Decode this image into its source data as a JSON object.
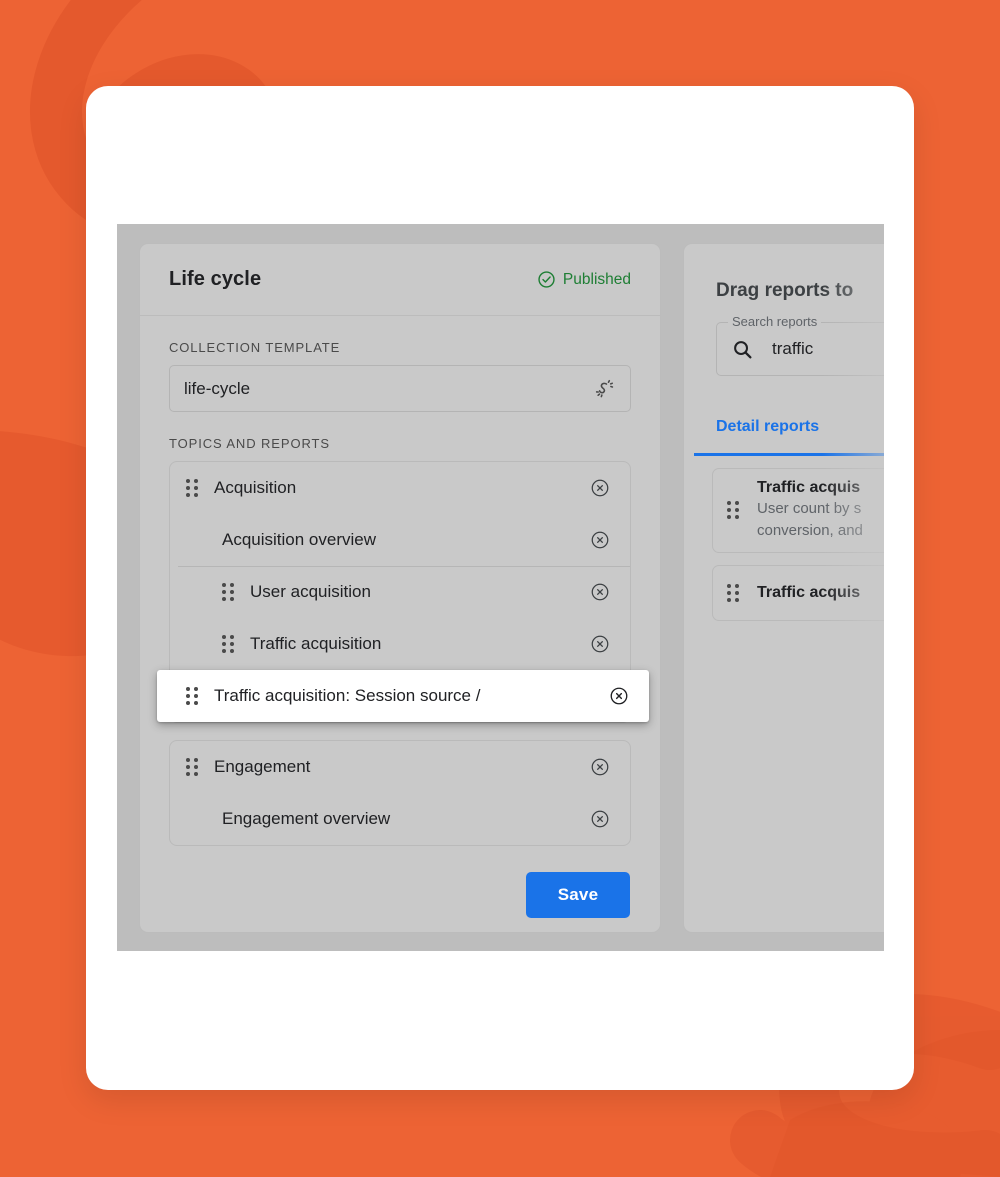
{
  "theme": {
    "background_color": "#ED6334",
    "panel_color": "#C9C9C9",
    "viewport_color": "#BDBDBD",
    "accent_blue": "#1A73E8",
    "published_green": "#1E7E34"
  },
  "collection_editor": {
    "title": "Life cycle",
    "status": {
      "label": "Published",
      "icon": "check-circle-icon"
    },
    "template_section_label": "COLLECTION TEMPLATE",
    "template_value": "life-cycle",
    "template_icon": "auto-generate-icon",
    "topics_section_label": "TOPICS AND REPORTS",
    "groups": [
      {
        "rows": [
          {
            "label": "Acquisition",
            "kind": "topic",
            "draggable": true,
            "separator_above": false
          },
          {
            "label": "Acquisition overview",
            "kind": "report",
            "draggable": false,
            "separator_above": false
          },
          {
            "label": "User acquisition",
            "kind": "report",
            "draggable": true,
            "separator_above": true
          },
          {
            "label": "Traffic acquisition",
            "kind": "report",
            "draggable": true,
            "separator_above": false
          },
          {
            "label": "Traffic acquisition: Session source /",
            "kind": "report",
            "draggable": true,
            "separator_above": false,
            "dragging": true
          }
        ]
      },
      {
        "rows": [
          {
            "label": "Engagement",
            "kind": "topic",
            "draggable": true,
            "separator_above": false
          },
          {
            "label": "Engagement overview",
            "kind": "report",
            "draggable": false,
            "separator_above": false
          }
        ]
      }
    ],
    "remove_icon": "remove-circle-icon",
    "save_label": "Save"
  },
  "report_library": {
    "title": "Drag reports to",
    "search": {
      "legend": "Search reports",
      "value": "traffic",
      "icon": "search-icon"
    },
    "tabs": [
      {
        "label": "Detail reports",
        "active": true
      }
    ],
    "cards": [
      {
        "title": "Traffic acquis",
        "description": "User count by s\nconversion, and",
        "has_description": true
      },
      {
        "title": "Traffic acquis",
        "description": "",
        "has_description": false
      }
    ]
  }
}
